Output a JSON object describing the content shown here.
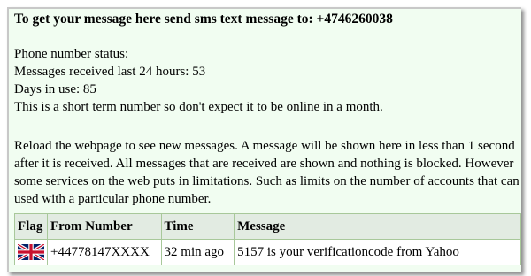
{
  "header": {
    "title": "To get your message here send sms text message to: +4746260038"
  },
  "status": {
    "label": "Phone number status:",
    "messages_received": "Messages received last 24 hours: 53",
    "days_in_use": "Days in use: 85",
    "note": "This is a short term number so don't expect it to be online in a month."
  },
  "info": {
    "lines": [
      "Reload the webpage to see new messages. A message will be shown here in less than 1 second",
      "after it is received. All messages that are received are shown and nothing is blocked. However",
      "some services on the web puts in limitations. Such as limits on the number of accounts that can be",
      "used with a particular phone number."
    ]
  },
  "table": {
    "headers": {
      "flag": "Flag",
      "from": "From Number",
      "time": "Time",
      "message": "Message"
    },
    "rows": [
      {
        "flag_icon": "uk-flag-icon",
        "from": "+44778147XXXX",
        "time": "32 min ago",
        "message": "5157 is your verificationcode from Yahoo"
      }
    ]
  }
}
